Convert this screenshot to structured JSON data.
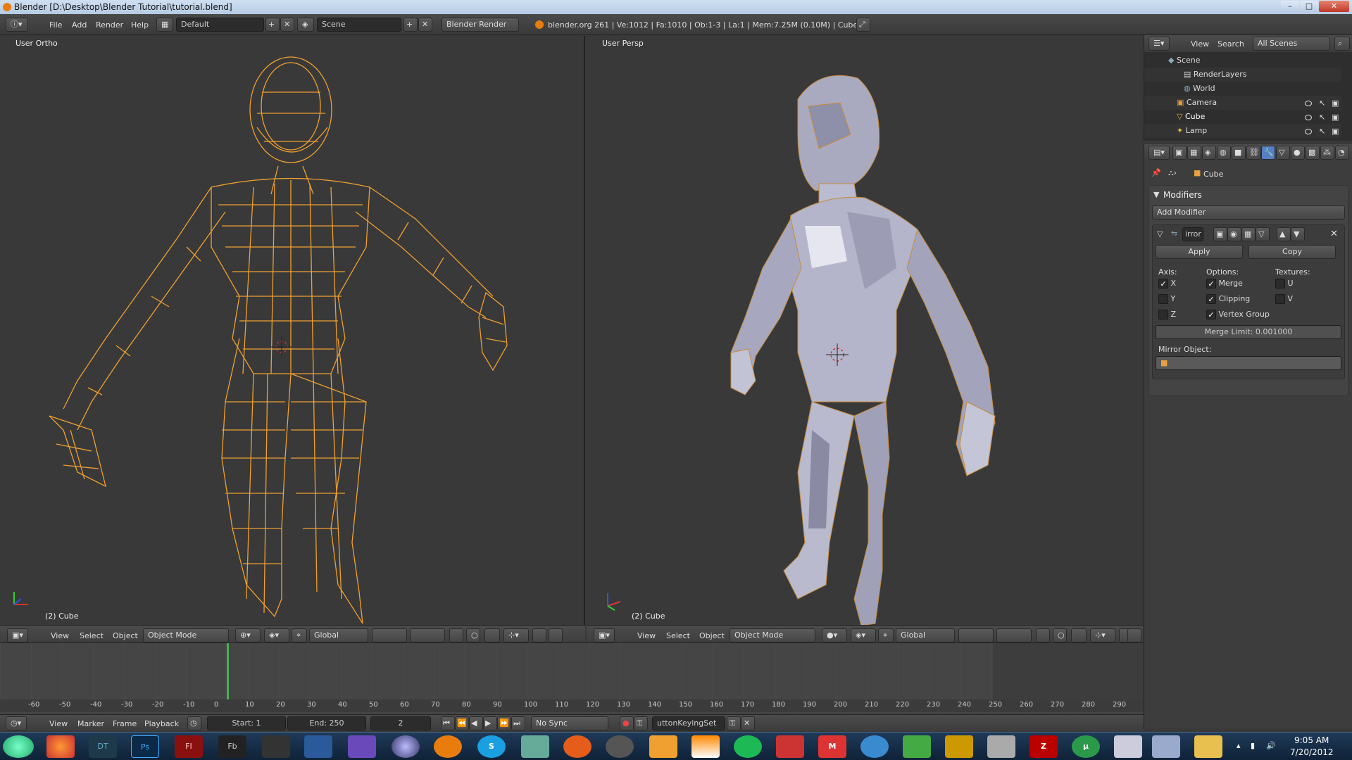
{
  "window": {
    "title": "Blender [D:\\Desktop\\Blender Tutorial\\tutorial.blend]",
    "minimize": "–",
    "maximize": "□",
    "close": "✕"
  },
  "infobar": {
    "menus": [
      "File",
      "Add",
      "Render",
      "Help"
    ],
    "layout": "Default",
    "scene": "Scene",
    "engine": "Blender Render",
    "stats": "blender.org 261 | Ve:1012 | Fa:1010 | Ob:1-3 | La:1 | Mem:7.25M (0.10M) | Cube"
  },
  "viewport_left": {
    "label": "User Ortho",
    "object": "(2) Cube"
  },
  "viewport_right": {
    "label": "User Persp",
    "object": "(2) Cube"
  },
  "view_header": {
    "menus": [
      "View",
      "Select",
      "Object"
    ],
    "mode": "Object Mode",
    "orientation": "Global"
  },
  "outliner": {
    "menus": [
      "View",
      "Search"
    ],
    "filter": "All Scenes",
    "items": [
      {
        "label": "Scene"
      },
      {
        "label": "RenderLayers"
      },
      {
        "label": "World"
      },
      {
        "label": "Camera"
      },
      {
        "label": "Cube"
      },
      {
        "label": "Lamp"
      }
    ]
  },
  "properties": {
    "breadcrumb": "Cube",
    "panel_title": "Modifiers",
    "add_modifier": "Add Modifier",
    "modifier_name": "irror",
    "apply": "Apply",
    "copy": "Copy",
    "axis_label": "Axis:",
    "options_label": "Options:",
    "textures_label": "Textures:",
    "axis": [
      {
        "label": "X",
        "checked": true
      },
      {
        "label": "Y",
        "checked": false
      },
      {
        "label": "Z",
        "checked": false
      }
    ],
    "options": [
      {
        "label": "Merge",
        "checked": true
      },
      {
        "label": "Clipping",
        "checked": true
      },
      {
        "label": "Vertex Group",
        "checked": true
      }
    ],
    "textures": [
      {
        "label": "U",
        "checked": false
      },
      {
        "label": "V",
        "checked": false
      }
    ],
    "merge_limit": "Merge Limit: 0.001000",
    "mirror_object_label": "Mirror Object:"
  },
  "timeline": {
    "ticks": [
      "-60",
      "-50",
      "-40",
      "-30",
      "-20",
      "-10",
      "0",
      "10",
      "20",
      "30",
      "40",
      "50",
      "60",
      "70",
      "80",
      "90",
      "100",
      "110",
      "120",
      "130",
      "140",
      "150",
      "160",
      "170",
      "180",
      "190",
      "200",
      "210",
      "220",
      "230",
      "240",
      "250",
      "260",
      "270",
      "280",
      "290"
    ],
    "current_frame": 2,
    "menus": [
      "View",
      "Marker",
      "Frame",
      "Playback"
    ],
    "start": "Start: 1",
    "end": "End: 250",
    "frame": "2",
    "sync": "No Sync",
    "keying_set": "uttonKeyingSet"
  },
  "taskbar": {
    "apps": [
      "start",
      "firefox",
      "dt",
      "photoshop",
      "flash",
      "flashbuilder",
      "app6",
      "app7",
      "app8",
      "eclipse",
      "blender",
      "skype",
      "app12",
      "origin",
      "steam",
      "app15",
      "vlc",
      "spotify",
      "app18",
      "app19",
      "app20",
      "app21",
      "app22",
      "app23",
      "filezilla",
      "utorrent",
      "calculator",
      "app27",
      "explorer"
    ],
    "time": "9:05 AM",
    "date": "7/20/2012"
  }
}
